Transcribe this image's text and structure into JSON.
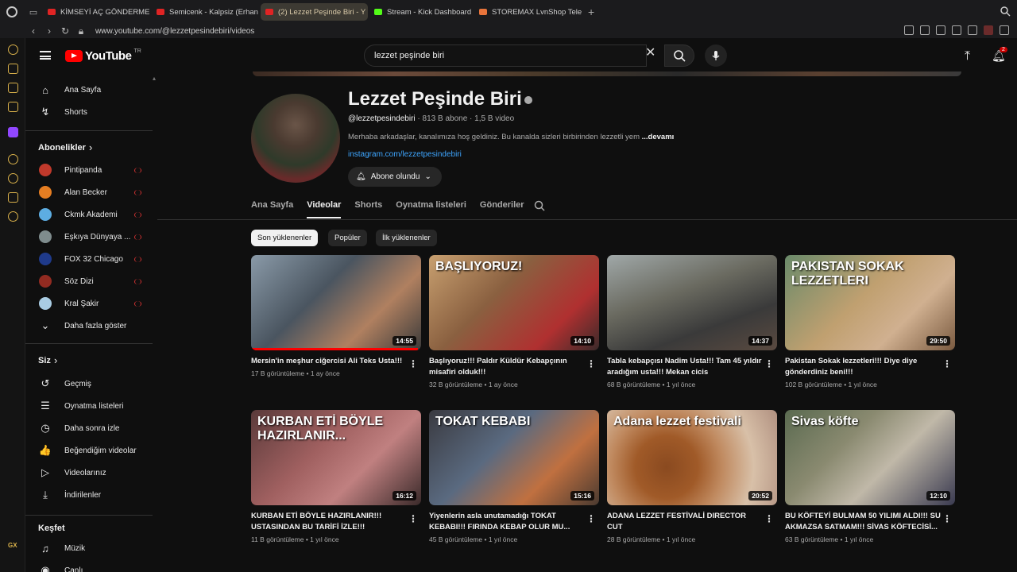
{
  "browser": {
    "tabs": [
      {
        "label": "KİMSEYİ AÇ GÖNDERMEM",
        "color": "#e02424"
      },
      {
        "label": "Semicenk - Kalpsiz (Erhan",
        "color": "#e02424"
      },
      {
        "label": "(2) Lezzet Peşinde Biri - Y",
        "color": "#e02424",
        "active": true
      },
      {
        "label": "Stream - Kick Dashboard",
        "color": "#53fc18"
      },
      {
        "label": "STOREMAX LvnShop Telef",
        "color": "#e8743b"
      }
    ],
    "url": "www.youtube.com/@lezzetpesindebiri/videos"
  },
  "youtube": {
    "logo_text": "YouTube",
    "country": "TR",
    "search_value": "lezzet peşinde biri",
    "notification_count": "2"
  },
  "sidebar": {
    "main": [
      {
        "label": "Ana Sayfa",
        "icon": "home-icon",
        "glyph": "⌂"
      },
      {
        "label": "Shorts",
        "icon": "shorts-icon",
        "glyph": "↯"
      }
    ],
    "subs_header": "Abonelikler",
    "subscriptions": [
      {
        "label": "Pintipanda",
        "color": "#c0392b",
        "live": true
      },
      {
        "label": "Alan Becker",
        "color": "#e67e22",
        "live": true
      },
      {
        "label": "Ckmk Akademi",
        "color": "#5dade2",
        "live": true
      },
      {
        "label": "Eşkıya Dünyaya ...",
        "color": "#7f8c8d",
        "live": true
      },
      {
        "label": "FOX 32 Chicago",
        "color": "#1f3a8a",
        "live": true
      },
      {
        "label": "Söz Dizi",
        "color": "#922b21",
        "live": true
      },
      {
        "label": "Kral Şakir",
        "color": "#a9cce3",
        "live": true
      }
    ],
    "show_more": "Daha fazla göster",
    "you_header": "Siz",
    "you_items": [
      {
        "label": "Geçmiş",
        "icon": "history-icon",
        "glyph": "↺"
      },
      {
        "label": "Oynatma listeleri",
        "icon": "playlist-icon",
        "glyph": "☰"
      },
      {
        "label": "Daha sonra izle",
        "icon": "watch-later-icon",
        "glyph": "◷"
      },
      {
        "label": "Beğendiğim videolar",
        "icon": "like-icon",
        "glyph": "👍"
      },
      {
        "label": "Videolarınız",
        "icon": "your-videos-icon",
        "glyph": "▷"
      },
      {
        "label": "İndirilenler",
        "icon": "download-icon",
        "glyph": "⤓"
      }
    ],
    "explore_header": "Keşfet",
    "explore_items": [
      {
        "label": "Müzik",
        "icon": "music-icon",
        "glyph": "♫"
      },
      {
        "label": "Canlı",
        "icon": "live-icon",
        "glyph": "◉"
      }
    ]
  },
  "channel": {
    "name": "Lezzet Peşinde Biri",
    "handle": "@lezzetpesindebiri",
    "subs": "813 B abone",
    "videos": "1,5 B video",
    "description": "Merhaba arkadaşlar, kanalımıza hoş geldiniz. Bu kanalda sizleri birbirinden lezzetli yem",
    "more": "...devamı",
    "link": "instagram.com/lezzetpesindebiri",
    "subscribed_label": "Abone olundu"
  },
  "tabs": [
    "Ana Sayfa",
    "Videolar",
    "Shorts",
    "Oynatma listeleri",
    "Gönderiler"
  ],
  "chips": [
    "Son yüklenenler",
    "Popüler",
    "İlk yüklenenler"
  ],
  "videos": [
    {
      "title": "Mersin'in meşhur ciğercisi Ali Teks Usta!!!",
      "views": "17 B görüntüleme",
      "age": "1 ay önce",
      "duration": "14:55",
      "overlay": "",
      "bg": "linear-gradient(135deg,#8a9aa8,#4a5560 40%,#b08060 70%,#3a3a3a)",
      "progress": 0.98
    },
    {
      "title": "Başlıyoruz!!! Paldır Küldür Kebapçının misafiri olduk!!!",
      "views": "32 B görüntüleme",
      "age": "1 ay önce",
      "duration": "14:10",
      "overlay": "BAŞLIYORUZ!",
      "bg": "linear-gradient(135deg,#c8a070,#8a6040 40%,#b03030 75%,#3a2a2a)",
      "progress": 0
    },
    {
      "title": "Tabla kebapçısı Nadim Usta!!! Tam 45 yıldır aradığım usta!!! Mekan cicis",
      "views": "68 B görüntüleme",
      "age": "1 yıl önce",
      "duration": "14:37",
      "overlay": "",
      "bg": "linear-gradient(160deg,#a0a8a8,#6a6a60 40%,#3a3a3a 70%,#5a4a40)",
      "progress": 0
    },
    {
      "title": "Pakistan Sokak lezzetleri!!! Diye diye gönderdiniz beni!!!",
      "views": "102 B görüntüleme",
      "age": "1 yıl önce",
      "duration": "29:50",
      "overlay": "PAKISTAN SOKAK LEZZETLERI",
      "bg": "linear-gradient(135deg,#6a8a6a,#c0a070 45%,#d0b090 70%,#7a5a40)",
      "progress": 0
    },
    {
      "title": "KURBAN ETİ BÖYLE HAZIRLANIR!!! USTASINDAN BU TARİFİ İZLE!!!",
      "views": "11 B görüntüleme",
      "age": "1 yıl önce",
      "duration": "16:12",
      "overlay": "KURBAN ETİ BÖYLE HAZIRLANIR...",
      "bg": "linear-gradient(135deg,#5a3a3a,#a06060 40%,#c08080 65%,#3a2a2a)",
      "progress": 0
    },
    {
      "title": "Yiyenlerin asla unutamadığı TOKAT KEBABI!!! FIRINDA KEBAP OLUR MU...",
      "views": "45 B görüntüleme",
      "age": "1 yıl önce",
      "duration": "15:16",
      "overlay": "TOKAT KEBABI",
      "bg": "linear-gradient(135deg,#3a3a40,#5a6a80 40%,#c07040 70%,#4a3a30)",
      "progress": 0
    },
    {
      "title": "ADANA LEZZET FESTİVALİ DIRECTOR CUT",
      "views": "28 B görüntüleme",
      "age": "1 yıl önce",
      "duration": "20:52",
      "overlay": "Adana lezzet festivali",
      "bg": "radial-gradient(circle at 35% 60%,#8a4a20 0,#a05a28 25%,#c08a60 45%,#d8c0a8 70%,#b09080)",
      "progress": 0
    },
    {
      "title": "BU KÖFTEYİ BULMAM 50 YILIMI ALDI!!! SU AKMAZSA SATMAM!!! SİVAS KÖFTECİSİ...",
      "views": "63 B görüntüleme",
      "age": "1 yıl önce",
      "duration": "12:10",
      "overlay": "Sivas köfte",
      "bg": "linear-gradient(135deg,#5a6a50,#8a8a70 35%,#c0b8a8 60%,#3a3a50)",
      "progress": 0
    }
  ],
  "more_icon": "vertical-dots-icon"
}
